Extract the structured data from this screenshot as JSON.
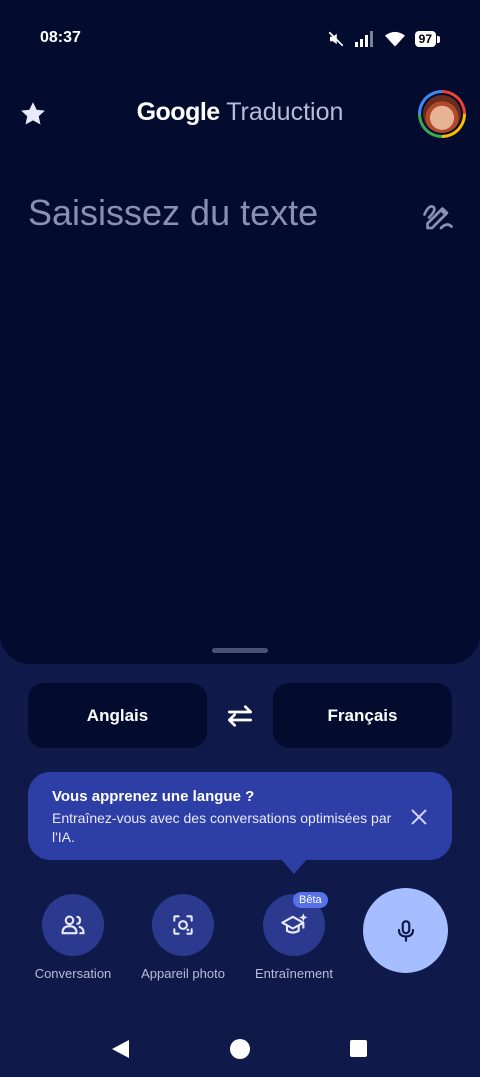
{
  "status_bar": {
    "time": "08:37",
    "battery": "97",
    "icons": [
      "mute-icon",
      "signal-icon",
      "wifi-icon",
      "battery-icon"
    ]
  },
  "header": {
    "title_brand": "Google",
    "title_product": "Traduction",
    "star_icon": "star-icon",
    "avatar": "avatar"
  },
  "input": {
    "placeholder": "Saisissez du texte",
    "handwrite_icon": "handwrite-icon"
  },
  "languages": {
    "source": "Anglais",
    "target": "Français",
    "swap_icon": "swap-icon"
  },
  "tooltip": {
    "title": "Vous apprenez une langue ?",
    "body": "Entraînez-vous avec des conversations optimisées par l'IA."
  },
  "actions": {
    "conversation": "Conversation",
    "camera": "Appareil photo",
    "practice": "Entraînement",
    "practice_badge": "Bêta"
  },
  "colors": {
    "background": "#0f1a4a",
    "input_panel": "#030b2e",
    "tooltip": "#2d3ea6",
    "action_circle": "#2b3a8f",
    "mic": "#a6bdff"
  }
}
